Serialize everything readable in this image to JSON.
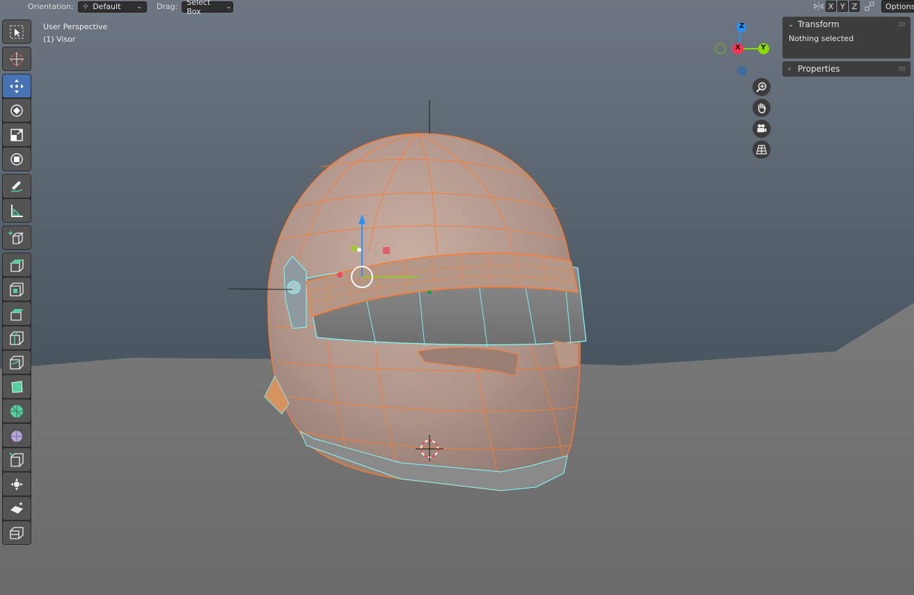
{
  "header": {
    "orientation_label": "Orientation:",
    "orientation_value": "Default",
    "drag_label": "Drag:",
    "drag_value": "Select Box",
    "axis_x": "X",
    "axis_y": "Y",
    "axis_z": "Z",
    "options_label": "Options"
  },
  "viewport": {
    "view_name": "User Perspective",
    "object_name": "(1) Visor"
  },
  "sidebar": {
    "transform_title": "Transform",
    "transform_status": "Nothing selected",
    "properties_title": "Properties"
  },
  "gizmo": {
    "z_label": "Z",
    "x_label": "X",
    "y_label": "Y"
  },
  "toolbar": {
    "active_tool": "move-tool",
    "tools": [
      "select-box-tool",
      "cursor-tool",
      "move-tool",
      "rotate-tool",
      "scale-tool",
      "transform-tool",
      "annotate-tool",
      "measure-tool",
      "add-cube-tool",
      "extrude-region-tool",
      "inset-faces-tool",
      "bevel-tool",
      "loop-cut-tool",
      "knife-tool",
      "poly-build-tool",
      "spin-tool",
      "smooth-tool",
      "edge-slide-tool",
      "shrink-fatten-tool",
      "shear-tool",
      "rip-region-tool"
    ]
  },
  "colors": {
    "accent_active": "#4772b3",
    "mesh_wire": "#ff7a2e",
    "selected_wire": "#7fffff",
    "axis_x": "#ff3352",
    "axis_y": "#8bdc00",
    "axis_z": "#2890ff"
  }
}
